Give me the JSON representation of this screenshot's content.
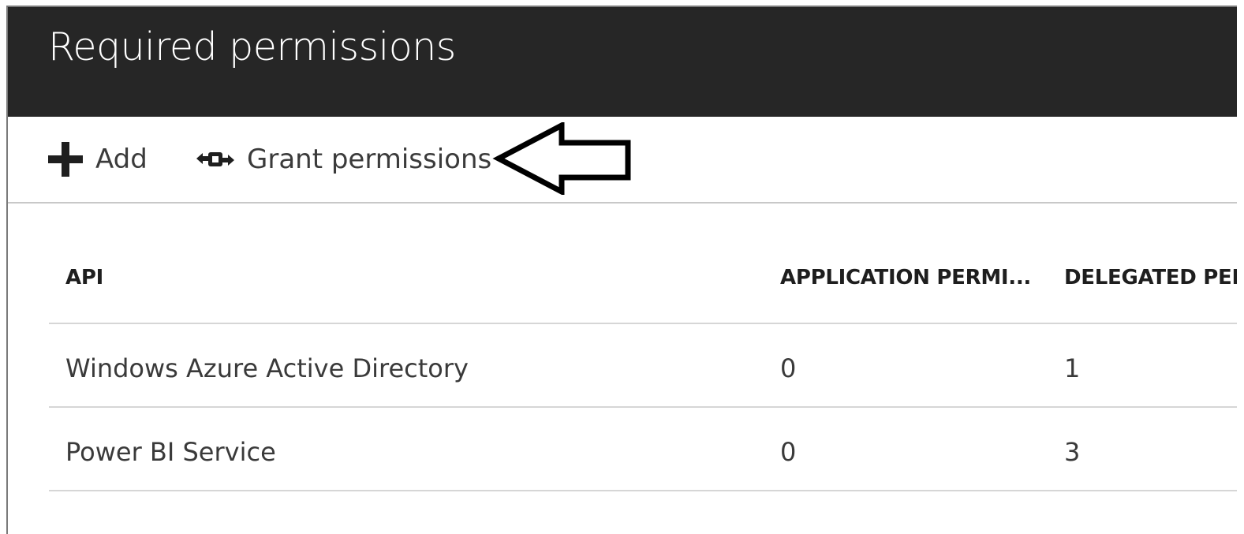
{
  "header": {
    "title": "Required permissions"
  },
  "toolbar": {
    "add_label": "Add",
    "grant_label": "Grant permissions"
  },
  "table": {
    "columns": [
      "API",
      "APPLICATION PERMI...",
      "DELEGATED PERMISSIONS"
    ],
    "rows": [
      {
        "api": "Windows Azure Active Directory",
        "application": "0",
        "delegated": "1"
      },
      {
        "api": "Power BI Service",
        "application": "0",
        "delegated": "3"
      }
    ]
  },
  "icons": {
    "add": "plus-icon",
    "grant": "grant-permissions-icon",
    "annotation": "left-arrow-annotation"
  },
  "colors": {
    "header_bg": "#262626",
    "header_text": "#ffffff",
    "text": "#3a3a3a",
    "divider": "#d6d6d6"
  }
}
